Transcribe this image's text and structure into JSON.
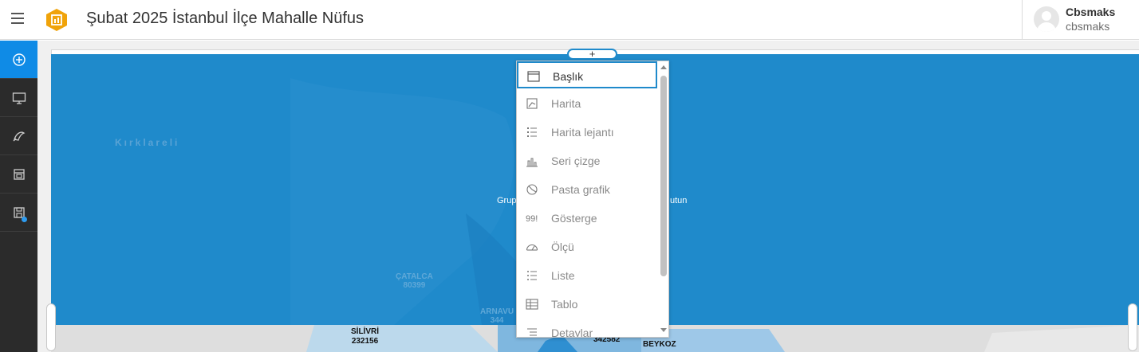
{
  "app": {
    "title": "Şubat 2025 İstanbul İlçe Mahalle Nüfus"
  },
  "user": {
    "name": "Cbsmaks",
    "username": "cbsmaks"
  },
  "sidebar": {
    "items": [
      {
        "icon": "add-circle-icon",
        "active": true
      },
      {
        "icon": "monitor-icon",
        "active": false
      },
      {
        "icon": "theme-icon",
        "active": false
      },
      {
        "icon": "preview-icon",
        "active": false
      },
      {
        "icon": "save-icon",
        "active": false,
        "badge": true
      }
    ]
  },
  "add_button": {
    "label": "+"
  },
  "add_menu": {
    "items": [
      {
        "label": "Başlık",
        "icon": "header-icon",
        "selected": true
      },
      {
        "label": "Harita",
        "icon": "map-icon"
      },
      {
        "label": "Harita lejantı",
        "icon": "legend-icon"
      },
      {
        "label": "Seri çizge",
        "icon": "serial-chart-icon"
      },
      {
        "label": "Pasta grafik",
        "icon": "pie-chart-icon"
      },
      {
        "label": "Gösterge",
        "icon": "indicator-icon"
      },
      {
        "label": "Ölçü",
        "icon": "gauge-icon"
      },
      {
        "label": "Liste",
        "icon": "list-icon"
      },
      {
        "label": "Tablo",
        "icon": "table-icon"
      },
      {
        "label": "Detaylar",
        "icon": "details-icon"
      }
    ]
  },
  "map": {
    "labels": {
      "kirklareli": "Kırklareli",
      "grup": "Grup",
      "sutun": "utun",
      "catalca": "ÇATALCA",
      "catalca_pop": "80399",
      "arnavutkoy": "ARNAVU",
      "arnavutkoy_pop": "344",
      "silivri": "SİLİVRİ",
      "silivri_pop": "232156",
      "beykoz": "BEYKOZ",
      "pop_342582": "342582"
    }
  },
  "colors": {
    "accent": "#0f8be6",
    "map_blue": "#1f8acb",
    "sidebar_bg": "#2b2b2b"
  }
}
